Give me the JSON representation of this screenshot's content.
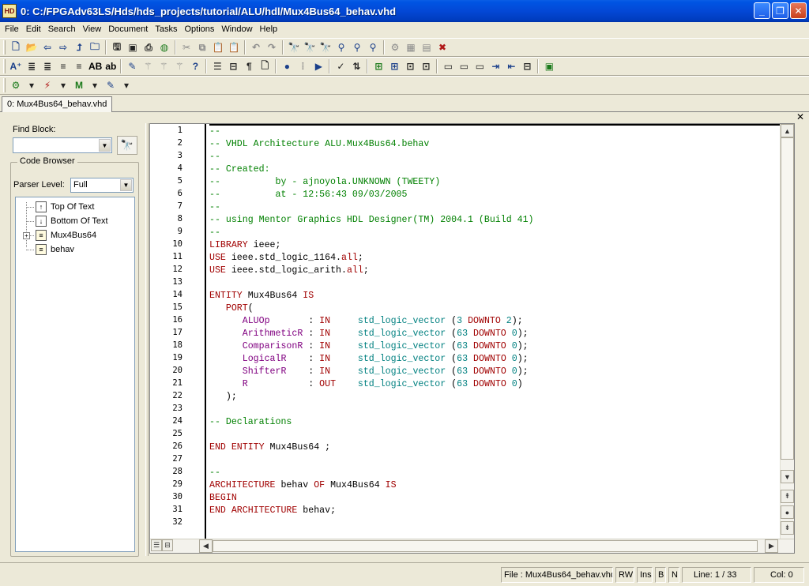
{
  "window": {
    "logo": "HD",
    "title": "0: C:/FPGAdv63LS/Hds/hds_projects/tutorial/ALU/hdl/Mux4Bus64_behav.vhd"
  },
  "menu": [
    "File",
    "Edit",
    "Search",
    "View",
    "Document",
    "Tasks",
    "Options",
    "Window",
    "Help"
  ],
  "toolbar2_text": {
    "ab_upper": "AB",
    "ab_lower": "ab"
  },
  "doc_tab": "0: Mux4Bus64_behav.vhd",
  "left_pane": {
    "find_label": "Find Block:",
    "find_value": "",
    "code_browser_label": "Code Browser",
    "parser_label": "Parser Level:",
    "parser_value": "Full",
    "tree": [
      {
        "label": "Top Of Text",
        "icon": "arrow-up-icon"
      },
      {
        "label": "Bottom Of Text",
        "icon": "arrow-down-icon"
      },
      {
        "label": "Mux4Bus64",
        "icon": "entity-icon"
      },
      {
        "label": "behav",
        "icon": "architecture-icon"
      }
    ]
  },
  "editor": {
    "line_numbers": [
      "1",
      "2",
      "3",
      "4",
      "5",
      "6",
      "7",
      "8",
      "9",
      "10",
      "11",
      "12",
      "13",
      "14",
      "15",
      "16",
      "17",
      "18",
      "19",
      "20",
      "21",
      "22",
      "23",
      "24",
      "25",
      "26",
      "27",
      "28",
      "29",
      "30",
      "31",
      "32"
    ],
    "lines": [
      [
        {
          "c": "c",
          "t": "--"
        }
      ],
      [
        {
          "c": "c",
          "t": "-- VHDL Architecture ALU.Mux4Bus64.behav"
        }
      ],
      [
        {
          "c": "c",
          "t": "--"
        }
      ],
      [
        {
          "c": "c",
          "t": "-- Created:"
        }
      ],
      [
        {
          "c": "c",
          "t": "--          by - ajnoyola.UNKNOWN (TWEETY)"
        }
      ],
      [
        {
          "c": "c",
          "t": "--          at - 12:56:43 09/03/2005"
        }
      ],
      [
        {
          "c": "c",
          "t": "--"
        }
      ],
      [
        {
          "c": "c",
          "t": "-- using Mentor Graphics HDL Designer(TM) 2004.1 (Build 41)"
        }
      ],
      [
        {
          "c": "c",
          "t": "--"
        }
      ],
      [
        {
          "c": "k",
          "t": "LIBRARY"
        },
        {
          "c": "n",
          "t": " ieee;"
        }
      ],
      [
        {
          "c": "k",
          "t": "USE"
        },
        {
          "c": "n",
          "t": " ieee.std_logic_1164."
        },
        {
          "c": "k",
          "t": "all"
        },
        {
          "c": "n",
          "t": ";"
        }
      ],
      [
        {
          "c": "k",
          "t": "USE"
        },
        {
          "c": "n",
          "t": " ieee.std_logic_arith."
        },
        {
          "c": "k",
          "t": "all"
        },
        {
          "c": "n",
          "t": ";"
        }
      ],
      [],
      [
        {
          "c": "k",
          "t": "ENTITY"
        },
        {
          "c": "n",
          "t": " Mux4Bus64 "
        },
        {
          "c": "k",
          "t": "IS"
        }
      ],
      [
        {
          "c": "n",
          "t": "   "
        },
        {
          "c": "k",
          "t": "PORT"
        },
        {
          "c": "n",
          "t": "("
        }
      ],
      [
        {
          "c": "n",
          "t": "      "
        },
        {
          "c": "p",
          "t": "ALUOp"
        },
        {
          "c": "n",
          "t": "       : "
        },
        {
          "c": "k",
          "t": "IN"
        },
        {
          "c": "n",
          "t": "     "
        },
        {
          "c": "t",
          "t": "std_logic_vector"
        },
        {
          "c": "n",
          "t": " ("
        },
        {
          "c": "t",
          "t": "3"
        },
        {
          "c": "n",
          "t": " "
        },
        {
          "c": "k",
          "t": "DOWNTO"
        },
        {
          "c": "n",
          "t": " "
        },
        {
          "c": "t",
          "t": "2"
        },
        {
          "c": "n",
          "t": ");"
        }
      ],
      [
        {
          "c": "n",
          "t": "      "
        },
        {
          "c": "p",
          "t": "ArithmeticR"
        },
        {
          "c": "n",
          "t": " : "
        },
        {
          "c": "k",
          "t": "IN"
        },
        {
          "c": "n",
          "t": "     "
        },
        {
          "c": "t",
          "t": "std_logic_vector"
        },
        {
          "c": "n",
          "t": " ("
        },
        {
          "c": "t",
          "t": "63"
        },
        {
          "c": "n",
          "t": " "
        },
        {
          "c": "k",
          "t": "DOWNTO"
        },
        {
          "c": "n",
          "t": " "
        },
        {
          "c": "t",
          "t": "0"
        },
        {
          "c": "n",
          "t": ");"
        }
      ],
      [
        {
          "c": "n",
          "t": "      "
        },
        {
          "c": "p",
          "t": "ComparisonR"
        },
        {
          "c": "n",
          "t": " : "
        },
        {
          "c": "k",
          "t": "IN"
        },
        {
          "c": "n",
          "t": "     "
        },
        {
          "c": "t",
          "t": "std_logic_vector"
        },
        {
          "c": "n",
          "t": " ("
        },
        {
          "c": "t",
          "t": "63"
        },
        {
          "c": "n",
          "t": " "
        },
        {
          "c": "k",
          "t": "DOWNTO"
        },
        {
          "c": "n",
          "t": " "
        },
        {
          "c": "t",
          "t": "0"
        },
        {
          "c": "n",
          "t": ");"
        }
      ],
      [
        {
          "c": "n",
          "t": "      "
        },
        {
          "c": "p",
          "t": "LogicalR"
        },
        {
          "c": "n",
          "t": "    : "
        },
        {
          "c": "k",
          "t": "IN"
        },
        {
          "c": "n",
          "t": "     "
        },
        {
          "c": "t",
          "t": "std_logic_vector"
        },
        {
          "c": "n",
          "t": " ("
        },
        {
          "c": "t",
          "t": "63"
        },
        {
          "c": "n",
          "t": " "
        },
        {
          "c": "k",
          "t": "DOWNTO"
        },
        {
          "c": "n",
          "t": " "
        },
        {
          "c": "t",
          "t": "0"
        },
        {
          "c": "n",
          "t": ");"
        }
      ],
      [
        {
          "c": "n",
          "t": "      "
        },
        {
          "c": "p",
          "t": "ShifterR"
        },
        {
          "c": "n",
          "t": "    : "
        },
        {
          "c": "k",
          "t": "IN"
        },
        {
          "c": "n",
          "t": "     "
        },
        {
          "c": "t",
          "t": "std_logic_vector"
        },
        {
          "c": "n",
          "t": " ("
        },
        {
          "c": "t",
          "t": "63"
        },
        {
          "c": "n",
          "t": " "
        },
        {
          "c": "k",
          "t": "DOWNTO"
        },
        {
          "c": "n",
          "t": " "
        },
        {
          "c": "t",
          "t": "0"
        },
        {
          "c": "n",
          "t": ");"
        }
      ],
      [
        {
          "c": "n",
          "t": "      "
        },
        {
          "c": "p",
          "t": "R"
        },
        {
          "c": "n",
          "t": "           : "
        },
        {
          "c": "k",
          "t": "OUT"
        },
        {
          "c": "n",
          "t": "    "
        },
        {
          "c": "t",
          "t": "std_logic_vector"
        },
        {
          "c": "n",
          "t": " ("
        },
        {
          "c": "t",
          "t": "63"
        },
        {
          "c": "n",
          "t": " "
        },
        {
          "c": "k",
          "t": "DOWNTO"
        },
        {
          "c": "n",
          "t": " "
        },
        {
          "c": "t",
          "t": "0"
        },
        {
          "c": "n",
          "t": ")"
        }
      ],
      [
        {
          "c": "n",
          "t": "   );"
        }
      ],
      [],
      [
        {
          "c": "c",
          "t": "-- Declarations"
        }
      ],
      [],
      [
        {
          "c": "k",
          "t": "END"
        },
        {
          "c": "n",
          "t": " "
        },
        {
          "c": "k",
          "t": "ENTITY"
        },
        {
          "c": "n",
          "t": " Mux4Bus64 ;"
        }
      ],
      [],
      [
        {
          "c": "c",
          "t": "--"
        }
      ],
      [
        {
          "c": "k",
          "t": "ARCHITECTURE"
        },
        {
          "c": "n",
          "t": " behav "
        },
        {
          "c": "k",
          "t": "OF"
        },
        {
          "c": "n",
          "t": " Mux4Bus64 "
        },
        {
          "c": "k",
          "t": "IS"
        }
      ],
      [
        {
          "c": "k",
          "t": "BEGIN"
        }
      ],
      [
        {
          "c": "k",
          "t": "END"
        },
        {
          "c": "n",
          "t": " "
        },
        {
          "c": "k",
          "t": "ARCHITECTURE"
        },
        {
          "c": "n",
          "t": " behav;"
        }
      ],
      []
    ]
  },
  "status": {
    "file": "File : Mux4Bus64_behav.vhd",
    "mode": "RW",
    "ins": "Ins",
    "b": "B",
    "n": "N",
    "line": "Line: 1 / 33",
    "col": "Col: 0"
  },
  "colors": {
    "comment": "#008000",
    "keyword": "#a00000",
    "type": "#008080",
    "port": "#800080"
  }
}
